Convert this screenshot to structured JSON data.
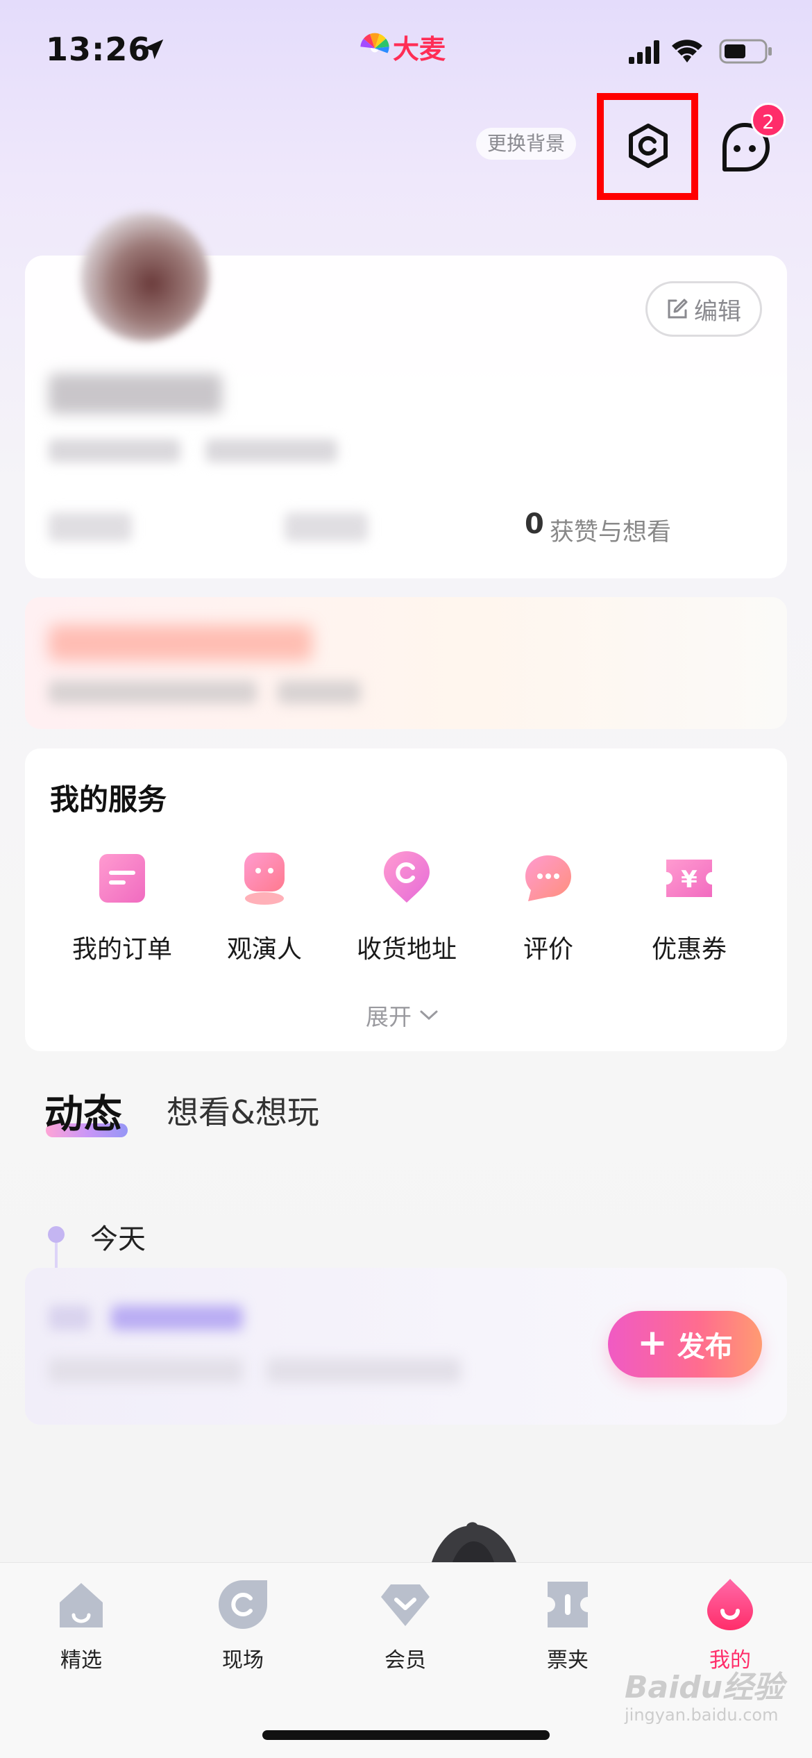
{
  "status_bar": {
    "time": "13:26",
    "brand": "大麦"
  },
  "header": {
    "change_background": "更换背景",
    "message_badge": "2"
  },
  "profile": {
    "edit_label": "编辑",
    "likes_count": "0",
    "likes_label": "获赞与想看"
  },
  "services": {
    "title": "我的服务",
    "items": [
      {
        "label": "我的订单",
        "icon": "order-icon"
      },
      {
        "label": "观演人",
        "icon": "audience-icon"
      },
      {
        "label": "收货地址",
        "icon": "address-icon"
      },
      {
        "label": "评价",
        "icon": "review-icon"
      },
      {
        "label": "优惠券",
        "icon": "coupon-icon"
      }
    ],
    "expand_label": "展开"
  },
  "feed_tabs": {
    "active": "动态",
    "inactive": "想看&想玩"
  },
  "timeline": {
    "today": "今天",
    "publish_label": "发布"
  },
  "tabbar": {
    "items": [
      {
        "label": "精选",
        "icon": "home-icon"
      },
      {
        "label": "现场",
        "icon": "live-icon"
      },
      {
        "label": "会员",
        "icon": "vip-icon"
      },
      {
        "label": "票夹",
        "icon": "ticket-icon"
      },
      {
        "label": "我的",
        "icon": "profile-icon",
        "active": true
      }
    ]
  },
  "watermark": {
    "main": "Baidu经验",
    "sub": "jingyan.baidu.com"
  },
  "colors": {
    "accent": "#ff2d6a",
    "highlight_box": "#ff0000"
  }
}
